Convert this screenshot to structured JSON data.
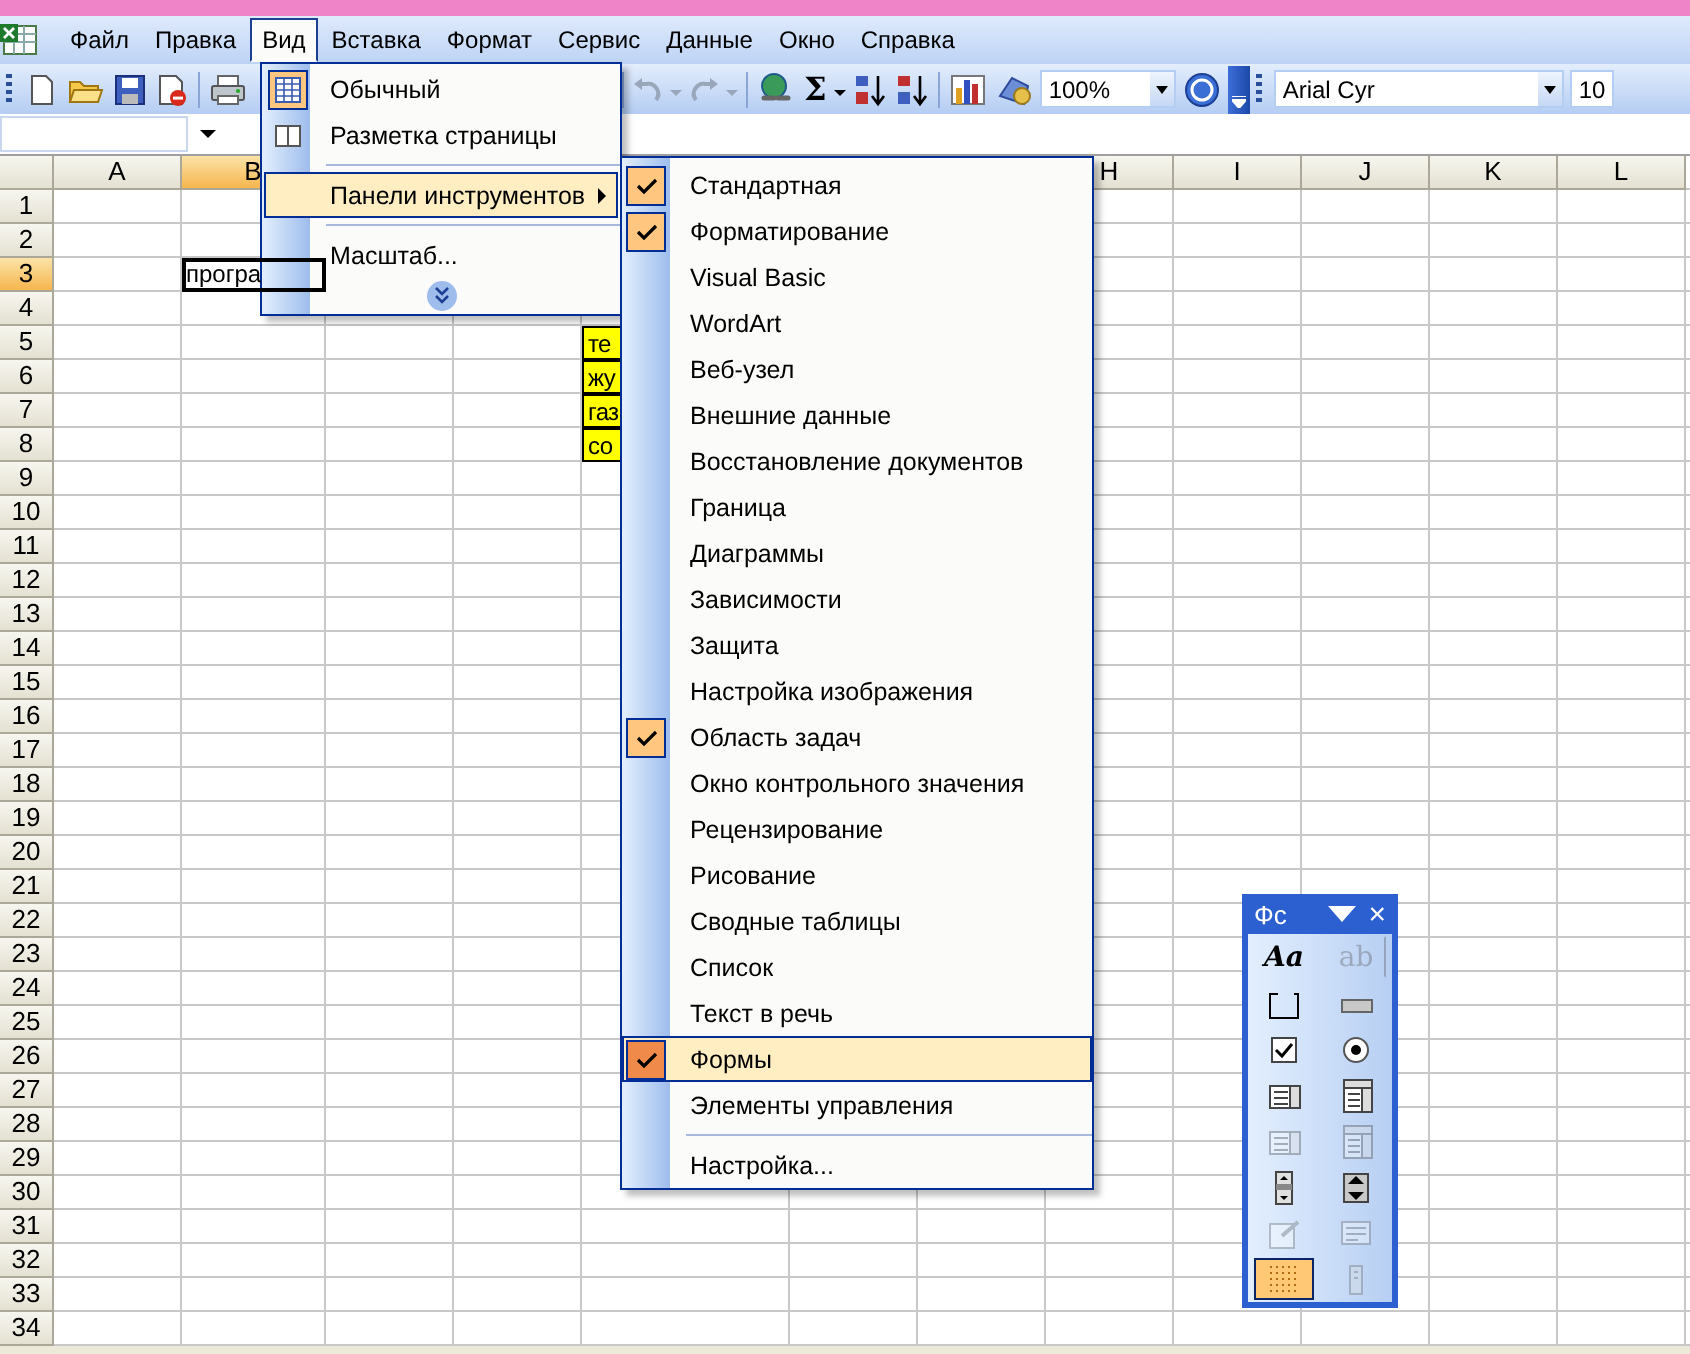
{
  "menubar": {
    "items": [
      {
        "label": "Файл",
        "selected": false
      },
      {
        "label": "Правка",
        "selected": false
      },
      {
        "label": "Вид",
        "selected": true
      },
      {
        "label": "Вставка",
        "selected": false
      },
      {
        "label": "Формат",
        "selected": false
      },
      {
        "label": "Сервис",
        "selected": false
      },
      {
        "label": "Данные",
        "selected": false
      },
      {
        "label": "Окно",
        "selected": false
      },
      {
        "label": "Справка",
        "selected": false
      }
    ]
  },
  "standard_toolbar": {
    "sum": "Σ",
    "zoom": "100%"
  },
  "formatting_toolbar": {
    "font": "Arial Cyr",
    "size": "10"
  },
  "sheet": {
    "columns": [
      {
        "label": "A",
        "selected": false
      },
      {
        "label": "B",
        "selected": true
      },
      {},
      {},
      {},
      {},
      {},
      {
        "label": "H",
        "selected": false
      },
      {
        "label": "I",
        "selected": false
      },
      {
        "label": "J",
        "selected": false
      },
      {
        "label": "K",
        "selected": false
      },
      {
        "label": "L",
        "selected": false
      }
    ],
    "rows": [
      {
        "label": "1",
        "selected": false
      },
      {
        "label": "2",
        "selected": false
      },
      {
        "label": "3",
        "selected": true,
        "cells": [
          {},
          {
            "text": "програ",
            "selected": true
          }
        ]
      },
      {
        "label": "4",
        "selected": false
      },
      {
        "label": "5",
        "selected": false,
        "cells": [
          {},
          {},
          {},
          {},
          {
            "text": "те",
            "highlighted": true
          }
        ]
      },
      {
        "label": "6",
        "selected": false,
        "cells": [
          {},
          {},
          {},
          {},
          {
            "text": "жу",
            "highlighted": true
          }
        ]
      },
      {
        "label": "7",
        "selected": false,
        "cells": [
          {},
          {},
          {},
          {},
          {
            "text": "газ",
            "highlighted": true
          }
        ]
      },
      {
        "label": "8",
        "selected": false,
        "cells": [
          {},
          {},
          {},
          {},
          {
            "text": "со",
            "highlighted": true
          }
        ]
      },
      {
        "label": "9",
        "selected": false
      },
      {
        "label": "10",
        "selected": false
      },
      {
        "label": "11",
        "selected": false
      },
      {
        "label": "12",
        "selected": false
      },
      {
        "label": "13",
        "selected": false
      },
      {
        "label": "14",
        "selected": false
      },
      {
        "label": "15",
        "selected": false
      },
      {
        "label": "16",
        "selected": false
      },
      {
        "label": "17",
        "selected": false
      },
      {
        "label": "18",
        "selected": false
      },
      {
        "label": "19",
        "selected": false
      },
      {
        "label": "20",
        "selected": false
      },
      {
        "label": "21",
        "selected": false
      },
      {
        "label": "22",
        "selected": false
      },
      {
        "label": "23",
        "selected": false
      },
      {
        "label": "24",
        "selected": false
      },
      {
        "label": "25",
        "selected": false
      },
      {
        "label": "26",
        "selected": false
      },
      {
        "label": "27",
        "selected": false
      },
      {
        "label": "28",
        "selected": false
      },
      {
        "label": "29",
        "selected": false
      },
      {
        "label": "30",
        "selected": false
      },
      {
        "label": "31",
        "selected": false
      },
      {
        "label": "32",
        "selected": false
      },
      {
        "label": "33",
        "selected": false
      },
      {
        "label": "34",
        "selected": false
      }
    ]
  },
  "view_menu": {
    "items": [
      {
        "kind": "item",
        "label": "Обычный",
        "checked": true,
        "selected": false
      },
      {
        "kind": "item",
        "label": "Разметка страницы",
        "checked": false,
        "selected": false
      },
      {
        "kind": "separator"
      },
      {
        "kind": "submenu",
        "label": "Панели инструментов",
        "selected": true
      },
      {
        "kind": "separator"
      },
      {
        "kind": "item",
        "label": "Масштаб...",
        "checked": false,
        "selected": false
      },
      {
        "kind": "expand"
      }
    ]
  },
  "toolbars_menu": {
    "items": [
      {
        "label": "Стандартная",
        "checked": true,
        "selected": false
      },
      {
        "label": "Форматирование",
        "checked": true,
        "selected": false
      },
      {
        "label": "Visual Basic",
        "checked": false,
        "selected": false
      },
      {
        "label": "WordArt",
        "checked": false,
        "selected": false
      },
      {
        "label": "Веб-узел",
        "checked": false,
        "selected": false
      },
      {
        "label": "Внешние данные",
        "checked": false,
        "selected": false
      },
      {
        "label": "Восстановление документов",
        "checked": false,
        "selected": false
      },
      {
        "label": "Граница",
        "checked": false,
        "selected": false
      },
      {
        "label": "Диаграммы",
        "checked": false,
        "selected": false
      },
      {
        "label": "Зависимости",
        "checked": false,
        "selected": false
      },
      {
        "label": "Защита",
        "checked": false,
        "selected": false
      },
      {
        "label": "Настройка изображения",
        "checked": false,
        "selected": false
      },
      {
        "label": "Область задач",
        "checked": true,
        "selected": false
      },
      {
        "label": "Окно контрольного значения",
        "checked": false,
        "selected": false
      },
      {
        "label": "Рецензирование",
        "checked": false,
        "selected": false
      },
      {
        "label": "Рисование",
        "checked": false,
        "selected": false
      },
      {
        "label": "Сводные таблицы",
        "checked": false,
        "selected": false
      },
      {
        "label": "Список",
        "checked": false,
        "selected": false
      },
      {
        "label": "Текст в речь",
        "checked": false,
        "selected": false
      },
      {
        "label": "Формы",
        "checked": true,
        "selected": true
      },
      {
        "label": "Элементы управления",
        "checked": false,
        "selected": false
      }
    ],
    "customize": "Настройка..."
  },
  "forms_toolbar": {
    "title": "Фс",
    "close": "×",
    "buttons": [
      {
        "kind": "label",
        "glyph": "Aa",
        "disabled": false,
        "selected": false
      },
      {
        "kind": "edit-box",
        "glyph": "ab",
        "disabled": true,
        "selected": false
      },
      {
        "kind": "group-box",
        "disabled": false,
        "selected": false
      },
      {
        "kind": "button",
        "disabled": false,
        "selected": false
      },
      {
        "kind": "checkbox",
        "disabled": false,
        "selected": false
      },
      {
        "kind": "option",
        "disabled": false,
        "selected": false
      },
      {
        "kind": "list-box",
        "disabled": false,
        "selected": false
      },
      {
        "kind": "combo-box",
        "disabled": false,
        "selected": false
      },
      {
        "kind": "list-box",
        "disabled": true,
        "selected": false
      },
      {
        "kind": "combo-box",
        "disabled": true,
        "selected": false
      },
      {
        "kind": "scroll-bar",
        "disabled": false,
        "selected": false
      },
      {
        "kind": "spinner",
        "disabled": false,
        "selected": false
      },
      {
        "kind": "properties",
        "disabled": true,
        "selected": false
      },
      {
        "kind": "code",
        "disabled": true,
        "selected": false
      },
      {
        "kind": "grid",
        "disabled": false,
        "selected": true
      },
      {
        "kind": "run",
        "disabled": true,
        "selected": false
      }
    ]
  }
}
